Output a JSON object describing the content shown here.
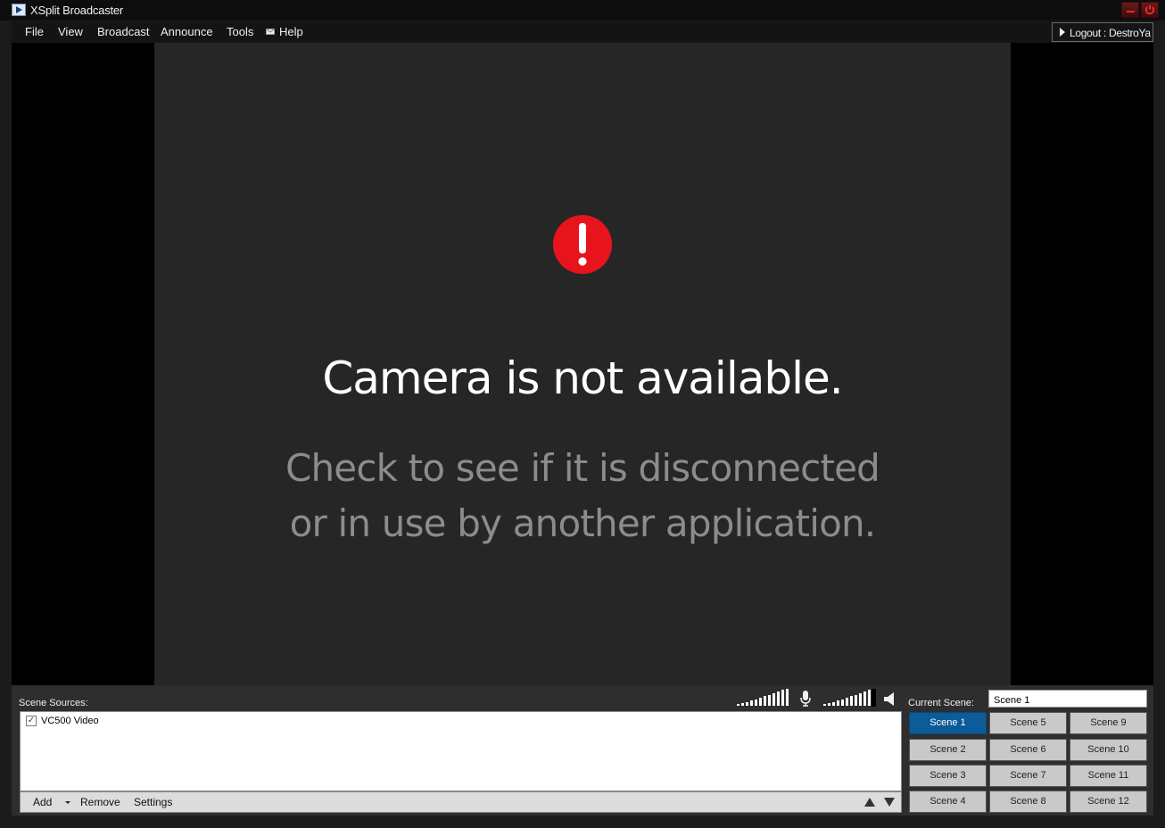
{
  "window": {
    "title": "XSplit Broadcaster"
  },
  "menu": {
    "items": [
      "File",
      "View",
      "Broadcast",
      "Announce",
      "Tools",
      "Help"
    ],
    "logout_label": "Logout : DestroYa"
  },
  "preview": {
    "title": "Camera is not available.",
    "line1": "Check to see if it is disconnected",
    "line2": "or in use by another application."
  },
  "sources": {
    "label": "Scene Sources:",
    "items": [
      {
        "name": "VC500 Video",
        "checked": true
      }
    ],
    "toolbar": {
      "add": "Add",
      "remove": "Remove",
      "settings": "Settings"
    }
  },
  "scenes": {
    "current_label": "Current Scene:",
    "current_value": "Scene 1",
    "buttons": [
      "Scene 1",
      "Scene 2",
      "Scene 3",
      "Scene 4",
      "Scene 5",
      "Scene 6",
      "Scene 7",
      "Scene 8",
      "Scene 9",
      "Scene 10",
      "Scene 11",
      "Scene 12"
    ],
    "active_index": 0
  },
  "colors": {
    "accent": "#0b5c98",
    "error": "#e8141b"
  },
  "icons": [
    "app-icon",
    "minimize-icon",
    "power-icon",
    "mail-icon",
    "play-triangle-icon",
    "alert-icon",
    "mic-icon",
    "speaker-icon"
  ]
}
